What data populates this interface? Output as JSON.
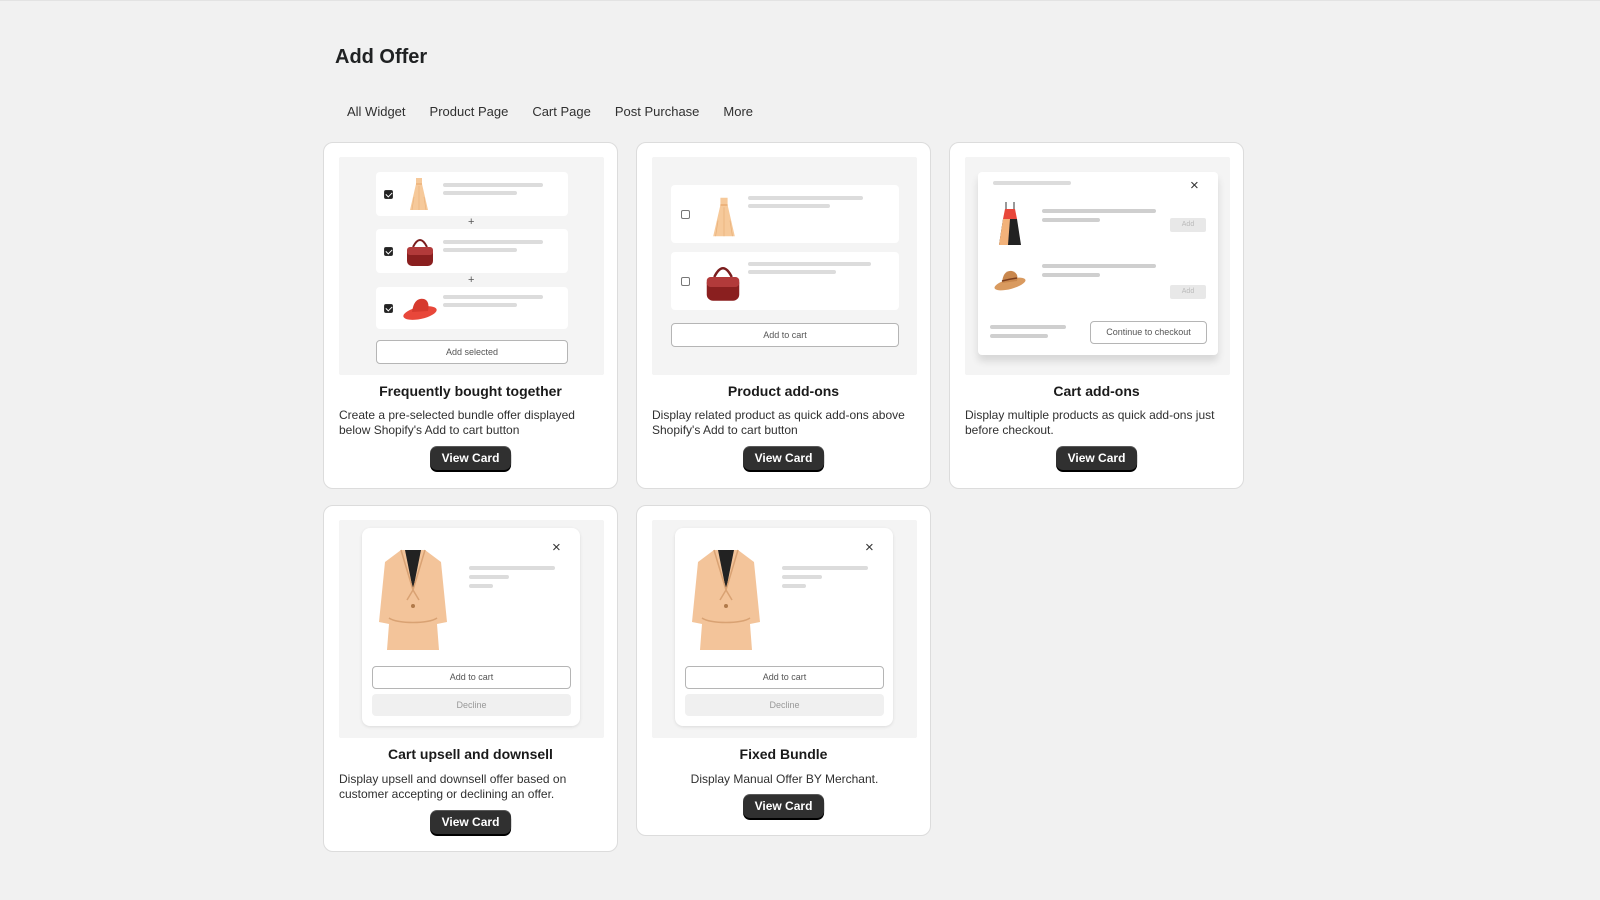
{
  "page": {
    "title": "Add Offer"
  },
  "tabs": [
    {
      "label": "All Widget"
    },
    {
      "label": "Product Page"
    },
    {
      "label": "Cart Page"
    },
    {
      "label": "Post Purchase"
    },
    {
      "label": "More"
    }
  ],
  "cards": [
    {
      "title": "Frequently bought together",
      "description": "Create a pre-selected bundle offer displayed below Shopify's Add to cart button",
      "button": "View Card",
      "preview": {
        "button": "Add selected",
        "separator": "+"
      }
    },
    {
      "title": "Product add-ons",
      "description": "Display related product as quick add-ons above Shopify's Add to cart button",
      "button": "View Card",
      "preview": {
        "button": "Add to cart"
      }
    },
    {
      "title": "Cart add-ons",
      "description": "Display multiple products as quick add-ons just before checkout.",
      "button": "View Card",
      "preview": {
        "button": "Continue to checkout",
        "add_label": "Add",
        "close": "×"
      }
    },
    {
      "title": "Cart upsell and downsell",
      "description": "Display upsell and downsell offer based on customer accepting or declining an offer.",
      "button": "View Card",
      "preview": {
        "accept": "Add to cart",
        "decline": "Decline",
        "close": "×"
      }
    },
    {
      "title": "Fixed Bundle",
      "description": "Display Manual Offer BY Merchant.",
      "button": "View Card",
      "preview": {
        "accept": "Add to cart",
        "decline": "Decline",
        "close": "×"
      }
    }
  ],
  "colors": {
    "page_bg": "#f1f1f1",
    "primary_button": "#303030",
    "card_border": "#dcdcdc"
  },
  "icons": [
    "checkbox-checked-icon",
    "checkbox-empty-icon",
    "close-icon",
    "dress-icon",
    "handbag-icon",
    "hat-icon",
    "coat-icon"
  ]
}
